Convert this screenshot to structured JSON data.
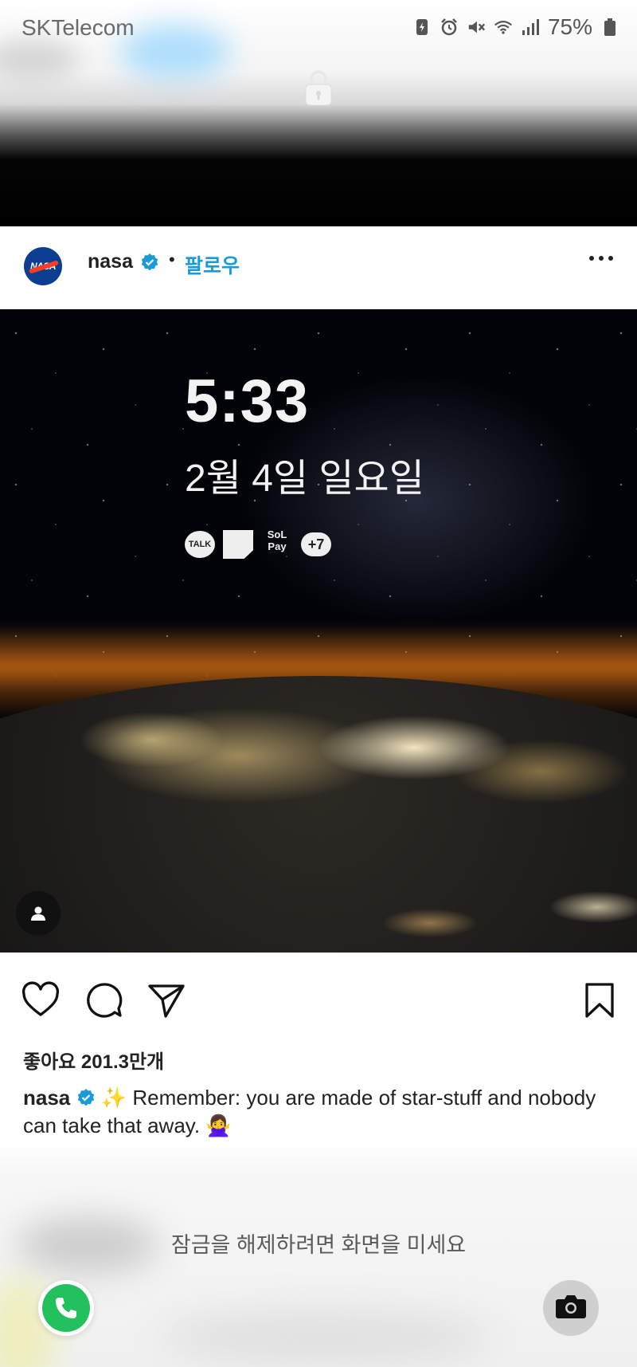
{
  "status_bar": {
    "carrier": "SKTelecom",
    "battery_percent": "75%",
    "icons": [
      "battery-saver-icon",
      "alarm-icon",
      "mute-icon",
      "wifi-icon",
      "signal-icon",
      "battery-icon"
    ]
  },
  "post": {
    "username": "nasa",
    "separator": "•",
    "follow_label": "팔로우",
    "likes": "좋아요 201.3만개",
    "caption_username": "nasa",
    "caption_text": "✨ Remember: you are made of star-stuff and nobody can take that away. 🙅‍♀️"
  },
  "lockscreen_overlay": {
    "time": "5:33",
    "date": "2월 4일 일요일",
    "notification_talk": "TALK",
    "notification_solpay_top": "SoL",
    "notification_solpay_bottom": "Pay",
    "notification_more": "+7"
  },
  "bottom": {
    "unlock_hint": "잠금을 해제하려면 화면을 미세요"
  },
  "colors": {
    "accent_blue": "#1a9bd7",
    "phone_green": "#22c15e"
  }
}
